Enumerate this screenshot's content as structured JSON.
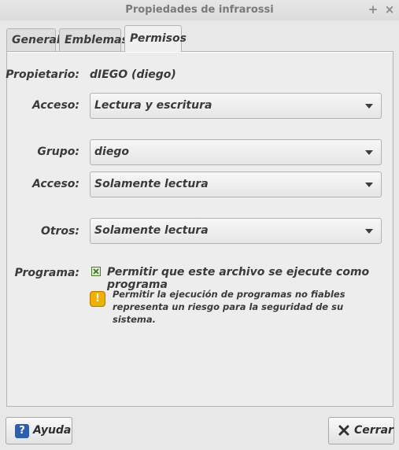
{
  "window": {
    "title": "Propiedades de infrarossi",
    "max_glyph": "+",
    "close_glyph": "×"
  },
  "tabs": [
    {
      "label": "General"
    },
    {
      "label": "Emblemas"
    },
    {
      "label": "Permisos"
    }
  ],
  "permissions": {
    "owner_label": "Propietario:",
    "owner_value": "dIEGO (diego)",
    "owner_access_label": "Acceso:",
    "owner_access_value": "Lectura y escritura",
    "group_label": "Grupo:",
    "group_value": "diego",
    "group_access_label": "Acceso:",
    "group_access_value": "Solamente lectura",
    "others_label": "Otros:",
    "others_value": "Solamente lectura",
    "program_label": "Programa:",
    "program_checkbox_label": "Permitir que este archivo se ejecute como programa",
    "program_checked": true,
    "warning_line1": "Permitir la ejecución de programas no fiables",
    "warning_line2": "representa un riesgo para la seguridad de su sistema."
  },
  "buttons": {
    "help_label": "Ayuda",
    "close_label": "Cerrar"
  },
  "icons": {
    "help": "help-icon",
    "close": "close-x-icon",
    "warning": "warning-icon",
    "check": "checkbox-checked-icon"
  },
  "colors": {
    "help_icon": "#2b5fb3",
    "warning_icon": "#f0b000",
    "check_green": "#4b7a2c"
  }
}
